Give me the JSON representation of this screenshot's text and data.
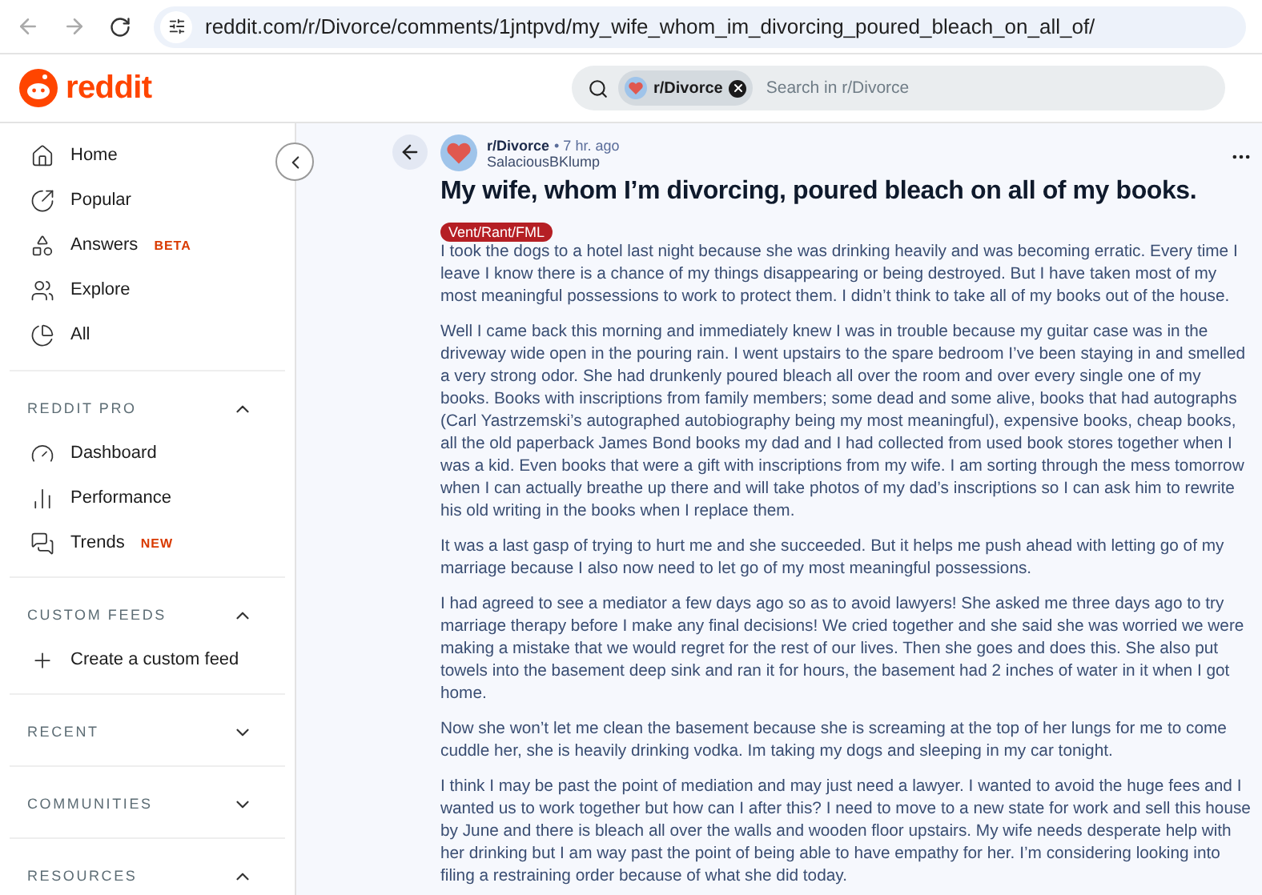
{
  "browser": {
    "url": "reddit.com/r/Divorce/comments/1jntpvd/my_wife_whom_im_divorcing_poured_bleach_on_all_of/"
  },
  "header": {
    "logo_text": "reddit",
    "search": {
      "chip": "r/Divorce",
      "placeholder": "Search in r/Divorce"
    }
  },
  "sidebar": {
    "nav": [
      {
        "label": "Home"
      },
      {
        "label": "Popular"
      },
      {
        "label": "Answers",
        "badge": "BETA"
      },
      {
        "label": "Explore"
      },
      {
        "label": "All"
      }
    ],
    "sections": [
      {
        "title": "REDDIT PRO",
        "expanded": true,
        "items": [
          {
            "label": "Dashboard"
          },
          {
            "label": "Performance"
          },
          {
            "label": "Trends",
            "badge": "NEW"
          }
        ]
      },
      {
        "title": "CUSTOM FEEDS",
        "expanded": true,
        "items": [
          {
            "label": "Create a custom feed"
          }
        ]
      },
      {
        "title": "RECENT",
        "expanded": false
      },
      {
        "title": "COMMUNITIES",
        "expanded": false
      },
      {
        "title": "RESOURCES",
        "expanded": true
      }
    ]
  },
  "post": {
    "subreddit": "r/Divorce",
    "time": "• 7 hr. ago",
    "author": "SalaciousBKlump",
    "title": "My wife, whom I’m divorcing, poured bleach on all of my books.",
    "flair": "Vent/Rant/FML",
    "paragraphs": [
      "I took the dogs to a hotel last night because she was drinking heavily and was becoming erratic. Every time I leave I know there is a chance of my things disappearing or being destroyed. But I have taken most of my most meaningful possessions to work to protect them. I didn’t think to take all of my books out of the house.",
      "Well I came back this morning and immediately knew I was in trouble because my guitar case was in the driveway wide open in the pouring rain. I went upstairs to the spare bedroom I’ve been staying in and smelled a very strong odor. She had drunkenly poured bleach all over the room and over every single one of my books. Books with inscriptions from family members; some dead and some alive, books that had autographs (Carl Yastrzemski’s autographed autobiography being my most meaningful), expensive books, cheap books, all the old paperback James Bond books my dad and I had collected from used book stores together when I was a kid. Even books that were a gift with inscriptions from my wife. I am sorting through the mess tomorrow when I can actually breathe up there and will take photos of my dad’s inscriptions so I can ask him to rewrite his old writing in the books when I replace them.",
      "It was a last gasp of trying to hurt me and she succeeded. But it helps me push ahead with letting go of my marriage because I also now need to let go of my most meaningful possessions.",
      "I had agreed to see a mediator a few days ago so as to avoid lawyers! She asked me three days ago to try marriage therapy before I make any final decisions! We cried together and she said she was worried we were making a mistake that we would regret for the rest of our lives. Then she goes and does this. She also put towels into the basement deep sink and ran it for hours, the basement had 2 inches of water in it when I got home.",
      "Now she won’t let me clean the basement because she is screaming at the top of her lungs for me to come cuddle her, she is heavily drinking vodka. Im taking my dogs and sleeping in my car tonight.",
      "I think I may be past the point of mediation and may just need a lawyer. I wanted to avoid the huge fees and I wanted us to work together but how can I after this? I need to move to a new state for work and sell this house by June and there is bleach all over the walls and wooden floor upstairs. My wife needs desperate help with her drinking but I am way past the point of being able to have empathy for her. I’m considering looking into filing a restraining order because of what she did today."
    ]
  }
}
